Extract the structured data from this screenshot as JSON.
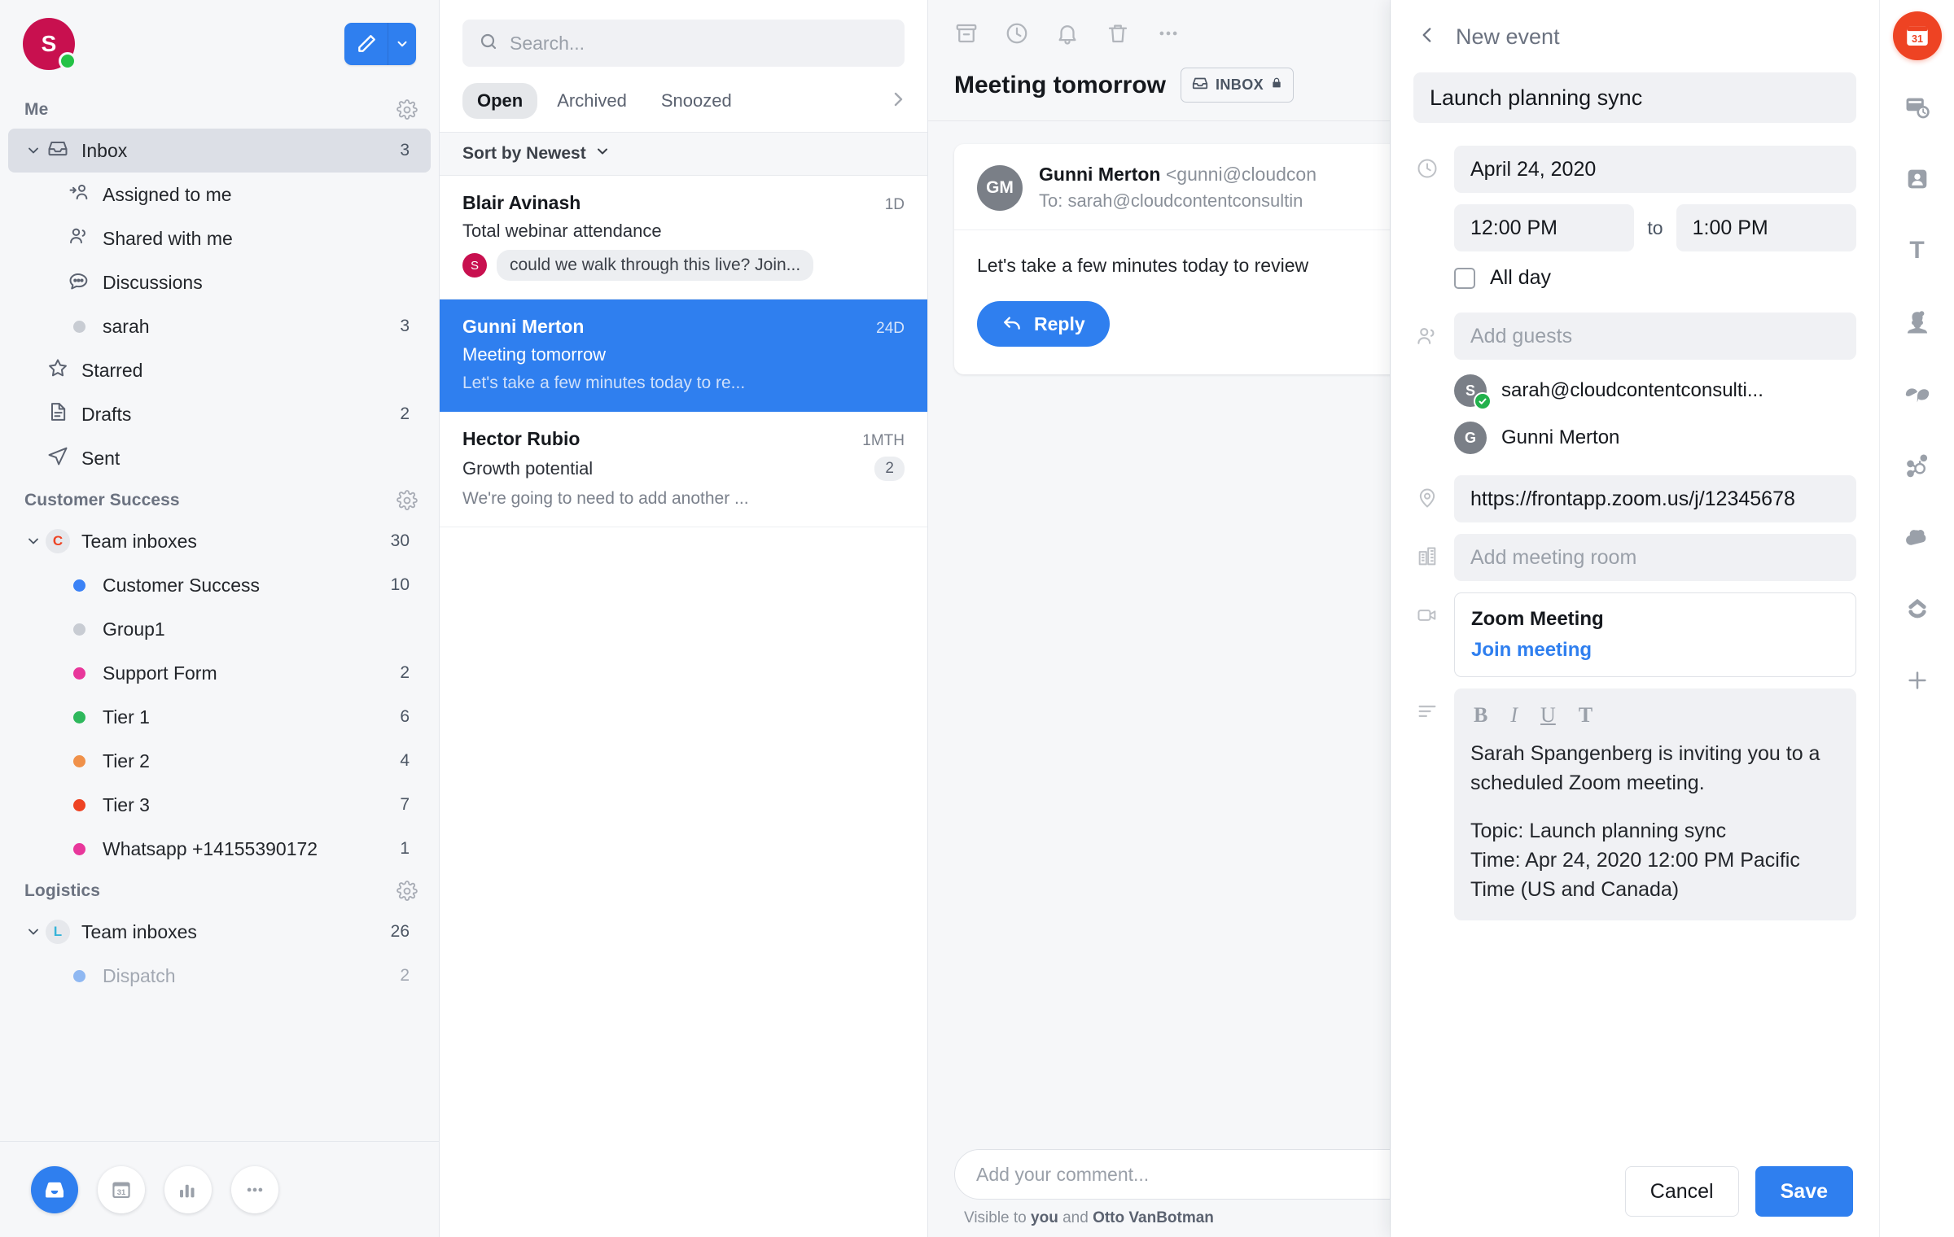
{
  "sidebar": {
    "avatar_initial": "S",
    "compose": {
      "pen_icon": "pencil-icon",
      "caret_icon": "chevron-down-icon"
    },
    "sections": [
      {
        "title": "Me",
        "items": [
          {
            "label": "Inbox",
            "count": "3",
            "icon": "inbox-icon",
            "selected": true,
            "level": 0,
            "chevron": true
          },
          {
            "label": "Assigned to me",
            "count": "",
            "icon": "assigned-user-icon",
            "level": 1
          },
          {
            "label": "Shared with me",
            "count": "",
            "icon": "users-icon",
            "level": 1
          },
          {
            "label": "Discussions",
            "count": "",
            "icon": "chat-bubble-icon",
            "level": 1
          },
          {
            "label": "sarah",
            "count": "3",
            "icon": "dot",
            "dot_color": "#c8ccd3",
            "level": 1
          },
          {
            "label": "Starred",
            "count": "",
            "icon": "star-icon",
            "level": 0.5
          },
          {
            "label": "Drafts",
            "count": "2",
            "icon": "document-icon",
            "level": 0.5
          },
          {
            "label": "Sent",
            "count": "",
            "icon": "send-icon",
            "level": 0.5
          }
        ]
      },
      {
        "title": "Customer Success",
        "items": [
          {
            "label": "Team inboxes",
            "count": "30",
            "icon": "letter-badge",
            "badge_letter": "C",
            "badge_color": "#ee4323",
            "level": 0,
            "chevron": true
          },
          {
            "label": "Customer Success",
            "count": "10",
            "icon": "dot",
            "dot_color": "#3b82f6",
            "level": 1
          },
          {
            "label": "Group1",
            "count": "",
            "icon": "dot",
            "dot_color": "#c8ccd3",
            "level": 1
          },
          {
            "label": "Support Form",
            "count": "2",
            "icon": "dot",
            "dot_color": "#e8379b",
            "level": 1
          },
          {
            "label": "Tier 1",
            "count": "6",
            "icon": "dot",
            "dot_color": "#2eb85c",
            "level": 1
          },
          {
            "label": "Tier 2",
            "count": "4",
            "icon": "dot",
            "dot_color": "#f0914a",
            "level": 1
          },
          {
            "label": "Tier 3",
            "count": "7",
            "icon": "dot",
            "dot_color": "#ee4323",
            "level": 1
          },
          {
            "label": "Whatsapp +14155390172",
            "count": "1",
            "icon": "dot",
            "dot_color": "#e8379b",
            "level": 1
          }
        ]
      },
      {
        "title": "Logistics",
        "items": [
          {
            "label": "Team inboxes",
            "count": "26",
            "icon": "letter-badge",
            "badge_letter": "L",
            "badge_color": "#36b3d9",
            "level": 0,
            "chevron": true
          },
          {
            "label": "Dispatch",
            "count": "2",
            "icon": "dot",
            "dot_color": "#8fb8f2",
            "level": 1,
            "dim": true
          }
        ]
      }
    ],
    "bottom_nav": [
      {
        "name": "inbox-icon",
        "active": true
      },
      {
        "name": "calendar-icon",
        "active": false
      },
      {
        "name": "analytics-icon",
        "active": false
      },
      {
        "name": "more-icon",
        "active": false
      }
    ]
  },
  "list": {
    "search": {
      "placeholder": "Search...",
      "icon": "search-icon"
    },
    "tabs": [
      {
        "label": "Open",
        "active": true
      },
      {
        "label": "Archived",
        "active": false
      },
      {
        "label": "Snoozed",
        "active": false
      }
    ],
    "tabs_more_icon": "chevron-right-icon",
    "sort": {
      "label": "Sort by Newest",
      "icon": "chevron-down-icon"
    },
    "conversations": [
      {
        "name": "Blair Avinash",
        "time": "1D",
        "subject": "Total webinar attendance",
        "draft_avatar": "S",
        "draft_text": "could we walk through this live? Join...",
        "selected": false,
        "count": ""
      },
      {
        "name": "Gunni Merton",
        "time": "24D",
        "subject": "Meeting tomorrow",
        "preview": "Let's take a few minutes today to re...",
        "selected": true,
        "count": ""
      },
      {
        "name": "Hector Rubio",
        "time": "1MTH",
        "subject": "Growth potential",
        "preview": "We're going to need to add another ...",
        "selected": false,
        "count": "2"
      }
    ]
  },
  "conversation": {
    "toolbar": [
      {
        "name": "archive-icon"
      },
      {
        "name": "snooze-clock-icon"
      },
      {
        "name": "bell-icon"
      },
      {
        "name": "trash-icon"
      },
      {
        "name": "more-icon"
      }
    ],
    "title": "Meeting tomorrow",
    "inbox_chip": {
      "label": "INBOX",
      "icon": "inbox-icon",
      "lock_icon": "lock-icon"
    },
    "message": {
      "avatar_initials": "GM",
      "from_name": "Gunni Merton",
      "from_email": "<gunni@cloudcon",
      "to": "To: sarah@cloudcontentconsultin",
      "body": "Let's take a few minutes today to review",
      "reply_label": "Reply",
      "reply_icon": "reply-arrow-icon"
    },
    "comment": {
      "placeholder": "Add your comment...",
      "visible_prefix": "Visible to ",
      "visible_you": "you",
      "visible_and": " and ",
      "visible_person": "Otto VanBotman"
    }
  },
  "event_panel": {
    "back_icon": "chevron-left-icon",
    "header": "New event",
    "title_value": "Launch planning sync",
    "date": {
      "value": "April 24, 2020",
      "icon": "clock-icon"
    },
    "start_time": "12:00 PM",
    "time_separator": "to",
    "end_time": "1:00 PM",
    "all_day": {
      "label": "All day",
      "checked": false
    },
    "guests": {
      "icon": "users-icon",
      "placeholder": "Add guests",
      "people": [
        {
          "initial": "S",
          "name": "sarah@cloudcontentconsulti...",
          "confirmed": true
        },
        {
          "initial": "G",
          "name": "Gunni Merton",
          "confirmed": false
        }
      ]
    },
    "location": {
      "icon": "location-pin-icon",
      "value": "https://frontapp.zoom.us/j/12345678"
    },
    "meeting_room": {
      "icon": "building-icon",
      "placeholder": "Add meeting room"
    },
    "video": {
      "icon": "video-camera-icon",
      "title": "Zoom Meeting",
      "link_label": "Join meeting"
    },
    "description": {
      "icon": "align-left-icon",
      "tools": [
        {
          "name": "bold-icon",
          "glyph": "B"
        },
        {
          "name": "italic-icon",
          "glyph": "I"
        },
        {
          "name": "underline-icon",
          "glyph": "U"
        },
        {
          "name": "clear-format-icon",
          "glyph": "T"
        }
      ],
      "paragraph1": "Sarah Spangenberg is inviting you to a scheduled Zoom meeting.",
      "paragraph2_line1": "Topic: Launch planning sync",
      "paragraph2_line2": "Time: Apr 24, 2020 12:00 PM Pacific Time (US and Canada)"
    },
    "cancel_label": "Cancel",
    "save_label": "Save"
  },
  "rail": {
    "items": [
      {
        "name": "calendar-31-icon",
        "label": "31",
        "active": true
      },
      {
        "name": "snooze-box-icon",
        "active": false
      },
      {
        "name": "contact-card-icon",
        "active": false
      },
      {
        "name": "text-tool-icon",
        "label": "T",
        "active": false
      },
      {
        "name": "avatar-person-icon",
        "active": false
      },
      {
        "name": "drift-icon",
        "active": false
      },
      {
        "name": "hubspot-icon",
        "active": false
      },
      {
        "name": "cloud-icon",
        "active": false
      },
      {
        "name": "salesforce-icon",
        "active": false
      },
      {
        "name": "add-plugin-icon",
        "active": false
      }
    ]
  }
}
